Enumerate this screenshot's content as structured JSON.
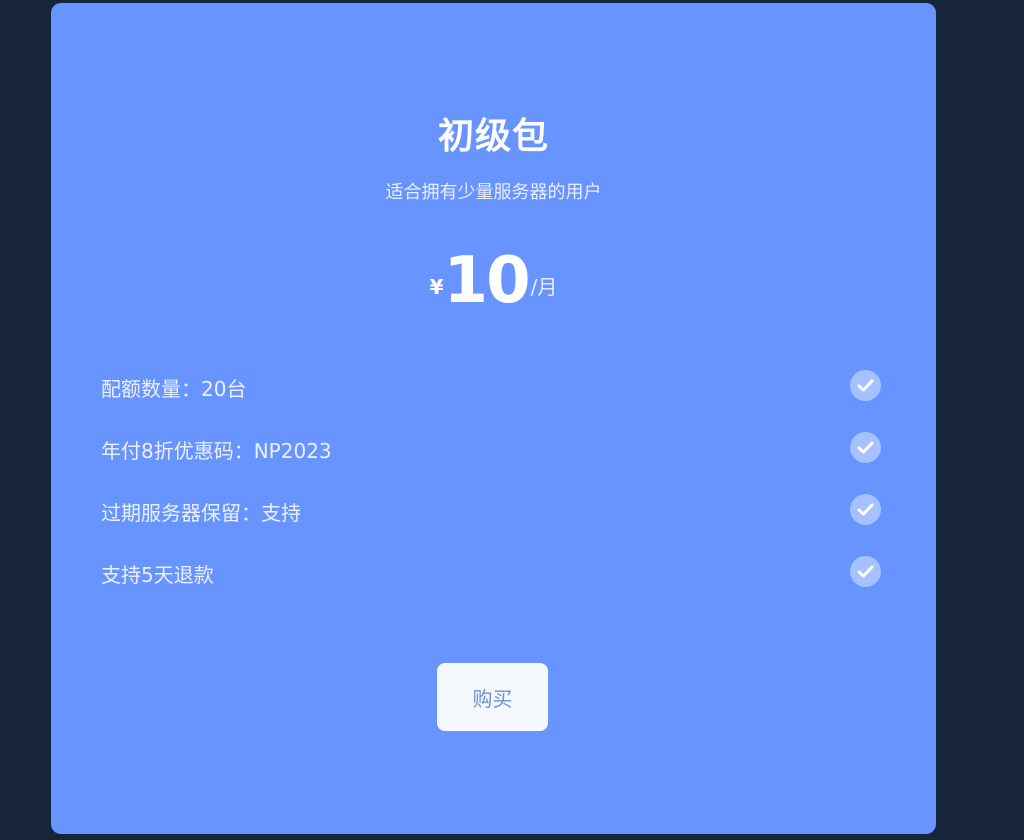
{
  "plan": {
    "title": "初级包",
    "subtitle": "适合拥有少量服务器的用户",
    "price": {
      "currency": "¥",
      "amount": "10",
      "separator": "/",
      "unit": "月"
    },
    "features": [
      {
        "label": "配额数量：20台",
        "icon": "check-icon"
      },
      {
        "label": "年付8折优惠码：NP2023",
        "icon": "check-icon"
      },
      {
        "label": "过期服务器保留：支持",
        "icon": "check-icon"
      },
      {
        "label": "支持5天退款",
        "icon": "check-icon"
      }
    ],
    "buy_label": "购买"
  },
  "colors": {
    "background": "#16253a",
    "card": "#6794ff",
    "check_circle": "#a6c1ff",
    "button_bg": "#f5f8fc",
    "button_text": "#6b8ed6"
  }
}
